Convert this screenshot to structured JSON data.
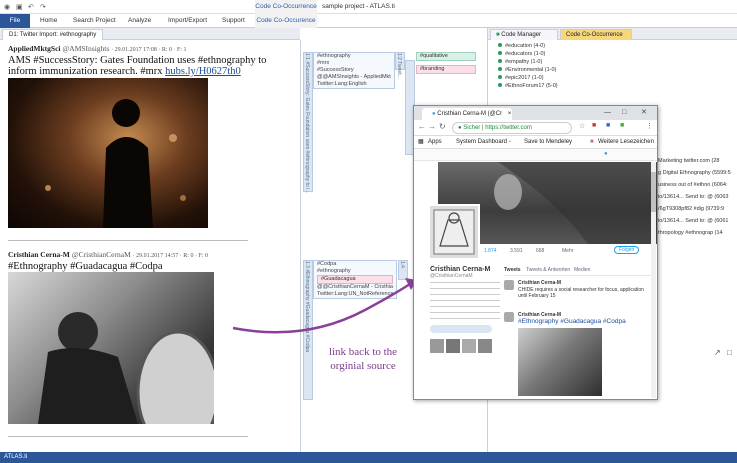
{
  "app": {
    "title": "sample project - ATLAS.ti",
    "context_tab": "Code Co-Occurrence",
    "status": "ATLAS.ti"
  },
  "ribbon": {
    "tabs": [
      "File",
      "Home",
      "Search Project",
      "Analyze",
      "Import/Export",
      "Support",
      "Code Co-Occurence"
    ]
  },
  "doc_tab": {
    "label": "D1: Twitter Import: #ethnography"
  },
  "right_tabs": [
    {
      "label": "Code Manager"
    },
    {
      "label": "Code Co-Occurrence"
    }
  ],
  "posts": [
    {
      "author": "AppliedMktgSci",
      "handle": "@AMSInsights",
      "meta": "· 29.01.2017 17:08 · R: 0 · F: 1",
      "text": "AMS #SuccessStory: Gates Foundation uses #ethnography to inform immunization research. #mrx",
      "link": "hubs.ly/H0627th0"
    },
    {
      "author": "Cristhian Cerna-M",
      "handle": "@CristhianCernaM",
      "meta": "· 29.01.2017 14:57 · R: 0 · F: 0",
      "text": "#Ethnography #Guadacagua #Codpa",
      "link": ""
    }
  ],
  "margin": {
    "quotation1": [
      "#ethnography",
      "#mrx",
      "#SuccessStory",
      "@@AMSInsights - AppliedMkt...",
      "Twitter:Lang:English"
    ],
    "strip1": "1:1 #SuccessStory: Gates Foundation uses #ethnography to i...",
    "strip1b": "1:2 Tweet...",
    "code_qual": "#qualitative",
    "code_brand": "#branding",
    "quotation2": [
      "#Codpa",
      "#ethnography",
      "#Guadacagua",
      "@@CristhianCernaM - Cristhia...",
      "Twitter:Lang:UN_NotReferenced"
    ],
    "strip2": "1:3 #Ethnography #Guadacagua #Codpa",
    "strip2b": "1:4"
  },
  "code_manager": {
    "rows": [
      "#education (4-0)",
      "#educators (1-0)",
      "#empathy (1-0)",
      "#Environmental (1-0)",
      "#epic2017 (1-0)",
      "#EthnoForum17 (5-0)"
    ]
  },
  "right_list": [
    "#Marketing twitter.com (28",
    "ng Digital Ethnography (5599:5",
    "business out of #ethno (6064:",
    "dio/13614... Send to: @ (6063",
    "o/6gT9308pf82 #dig (9739:9",
    "dio/13614... Send to: @ (6061",
    "nthropology #ethnograp (14"
  ],
  "browser": {
    "tab_title": "Cristhian Cerna-M (@Cr",
    "close": "×",
    "address": "Sicher | https://twitter.com",
    "bookmarks": [
      "Apps",
      "System Dashboard -",
      "Save to Mendeley",
      "Weitere Lesezeichen"
    ],
    "profile_name": "Cristhian Cerna-M",
    "profile_handle": "@CristhianCernaM",
    "stats": [
      "1.874",
      "3.591",
      "668",
      "Mehr"
    ],
    "tabs": [
      "Tweets",
      "Tweets & Antworten",
      "Medien"
    ],
    "tweet1_name": "Cristhian Cerna-M",
    "tweet1_text": "CHIDE requires a social researcher for focus, application until February 15",
    "tweet2_name": "Cristhian Cerna-M",
    "tweet2_text": "#Ethnography #Guadacagua #Codpa",
    "follow": "Folgen"
  },
  "annotation": "link back to the orginial source",
  "colors": {
    "accent": "#2b579a",
    "arrow": "#8a3f98",
    "code_green": "#2c9c5c",
    "tag_pink": "#fbe0ea",
    "tag_green": "#d8f0e6"
  }
}
